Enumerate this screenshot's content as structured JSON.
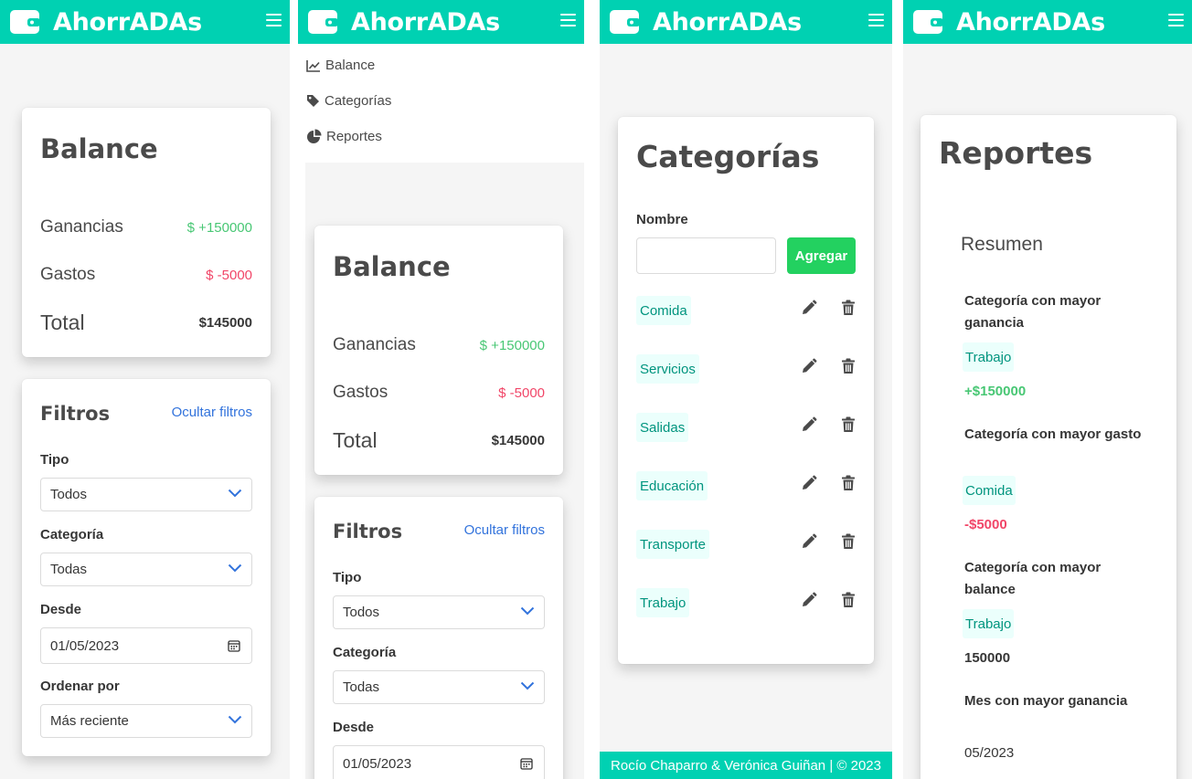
{
  "app": {
    "title": "AhorrADAs"
  },
  "colors": {
    "primary": "#00d1b2",
    "success": "#48c774",
    "danger": "#f14668",
    "link": "#3273dc",
    "agregar": "#23d160"
  },
  "icons": {
    "brand": "wallet-icon",
    "menu": "burger-menu-icon",
    "edit": "pencil-icon",
    "delete": "trash-icon"
  },
  "nav_menu": {
    "items": [
      {
        "label": "Balance",
        "icon": "chart-line-icon"
      },
      {
        "label": "Categorías",
        "icon": "tag-icon"
      },
      {
        "label": "Reportes",
        "icon": "pie-chart-icon"
      }
    ]
  },
  "balance": {
    "title": "Balance",
    "ganancias_label": "Ganancias",
    "ganancias_value": "$ +150000",
    "gastos_label": "Gastos",
    "gastos_value": "$ -5000",
    "total_label": "Total",
    "total_value": "$145000"
  },
  "filtros": {
    "title": "Filtros",
    "toggle_link": "Ocultar filtros",
    "tipo_label": "Tipo",
    "tipo_value": "Todos",
    "categoria_label": "Categoría",
    "categoria_value": "Todas",
    "desde_label": "Desde",
    "desde_value": "01/05/2023",
    "ordenar_label": "Ordenar por",
    "ordenar_value": "Más reciente"
  },
  "categorias": {
    "title": "Categorías",
    "nombre_label": "Nombre",
    "nombre_value": "",
    "agregar_label": "Agregar",
    "items": [
      "Comida",
      "Servicios",
      "Salidas",
      "Educación",
      "Transporte",
      "Trabajo"
    ]
  },
  "footer": {
    "text": "Rocío Chaparro & Verónica Guiñan | © 2023"
  },
  "reportes": {
    "title": "Reportes",
    "resumen_title": "Resumen",
    "entries": [
      {
        "label": "Categoría con mayor ganancia",
        "tag": "Trabajo",
        "value": "+$150000"
      },
      {
        "label": "Categoría con mayor gasto",
        "tag": "Comida",
        "value": "-$5000"
      },
      {
        "label": "Categoría con mayor balance",
        "tag": "Trabajo",
        "value": "150000"
      },
      {
        "label": "Mes con mayor ganancia",
        "value": "05/2023"
      }
    ]
  }
}
